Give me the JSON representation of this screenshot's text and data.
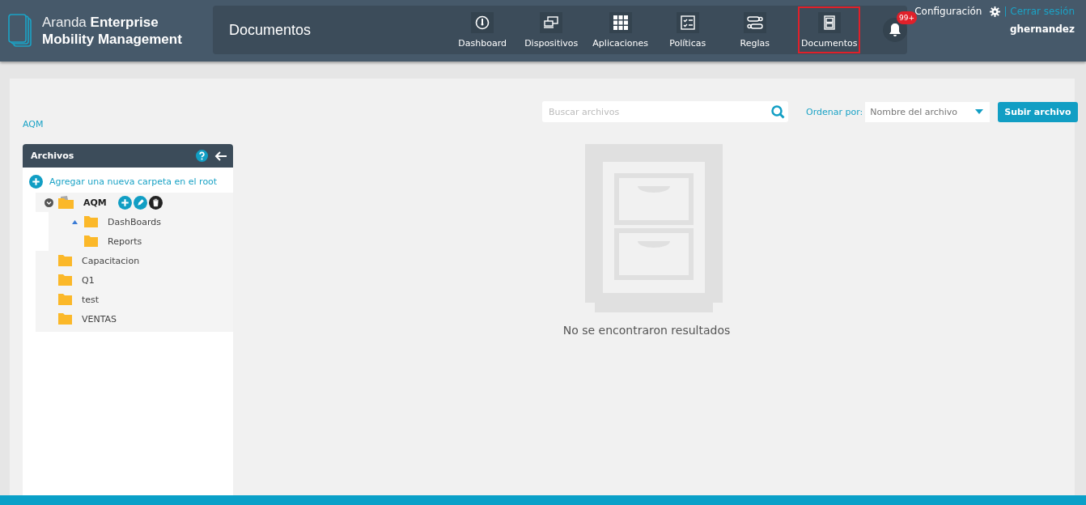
{
  "brand": {
    "light": "Aranda",
    "bold_1": "Enterprise",
    "bold_2": "Mobility Management"
  },
  "page_title": "Documentos",
  "nav": [
    {
      "label": "Dashboard",
      "kind": "gauge",
      "selected": false
    },
    {
      "label": "Dispositivos",
      "kind": "devices",
      "selected": false
    },
    {
      "label": "Aplicaciones",
      "kind": "grid",
      "selected": false
    },
    {
      "label": "Políticas",
      "kind": "checklist",
      "selected": false
    },
    {
      "label": "Reglas",
      "kind": "rules",
      "selected": false
    },
    {
      "label": "Documentos",
      "kind": "cabinet",
      "selected": true
    }
  ],
  "notifications": {
    "badge": "99+"
  },
  "user": {
    "settings": "Configuración",
    "logout": "| Cerrar sesión",
    "name": "ghernandez"
  },
  "breadcrumb": "AQM",
  "search": {
    "placeholder": "Buscar archivos"
  },
  "sort": {
    "label": "Ordenar por:",
    "value": "Nombre del archivo"
  },
  "upload_button": "Subir archivo",
  "panel": {
    "title": "Archivos",
    "add_root": "Agregar una nueva carpeta en el root",
    "tree": [
      {
        "name": "AQM",
        "selected": true,
        "expanded": true,
        "children": [
          {
            "name": "DashBoards",
            "selected": false,
            "toggle": true
          },
          {
            "name": "Reports",
            "selected": false,
            "toggle": false
          }
        ]
      },
      {
        "name": "Capacitacion",
        "selected": false,
        "toggle": false
      },
      {
        "name": "Q1",
        "selected": false,
        "toggle": false
      },
      {
        "name": "test",
        "selected": false,
        "toggle": false
      },
      {
        "name": "VENTAS",
        "selected": false,
        "toggle": false
      }
    ]
  },
  "empty_message": "No se encontraron resultados"
}
